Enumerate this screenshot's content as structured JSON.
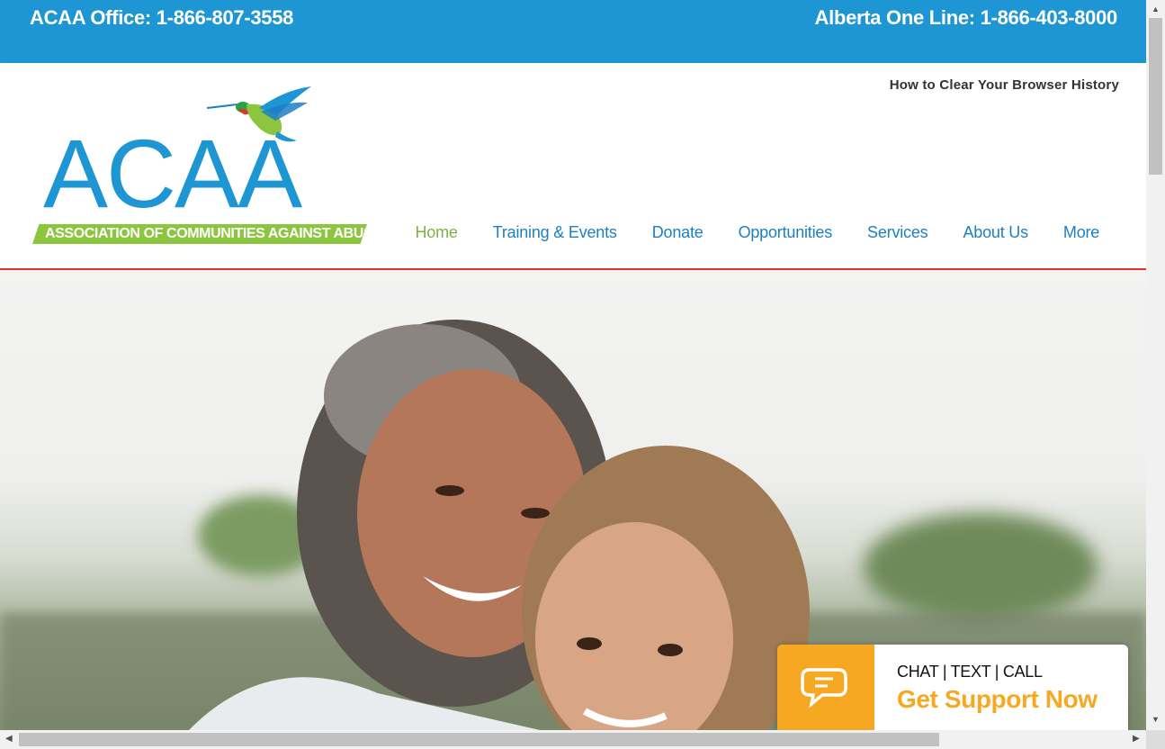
{
  "topbar": {
    "office_phone": "ACAA Office: 1-866-807-3558",
    "oneline_phone": "Alberta One Line: 1-866-403-8000",
    "background_color": "#1d96d3"
  },
  "header": {
    "clear_history_link": "How to Clear Your Browser History",
    "logo": {
      "letters": "ACAA",
      "tagline": "ASSOCIATION OF COMMUNITIES AGAINST ABUSE",
      "icon": "hummingbird-icon"
    },
    "nav": [
      {
        "label": "Home",
        "active": true
      },
      {
        "label": "Training & Events",
        "active": false
      },
      {
        "label": "Donate",
        "active": false
      },
      {
        "label": "Opportunities",
        "active": false
      },
      {
        "label": "Services",
        "active": false
      },
      {
        "label": "About Us",
        "active": false
      },
      {
        "label": "More",
        "active": false
      }
    ],
    "nav_color": "#1d7fc4",
    "active_color": "#7cb342",
    "accent_border": "#e5332a"
  },
  "hero": {
    "image": "hero-photo-grandmother-and-child"
  },
  "support_widget": {
    "icon": "chat-bubbles-icon",
    "subtitle": "CHAT | TEXT | CALL",
    "title": "Get Support Now",
    "accent_color": "#f7a823"
  }
}
